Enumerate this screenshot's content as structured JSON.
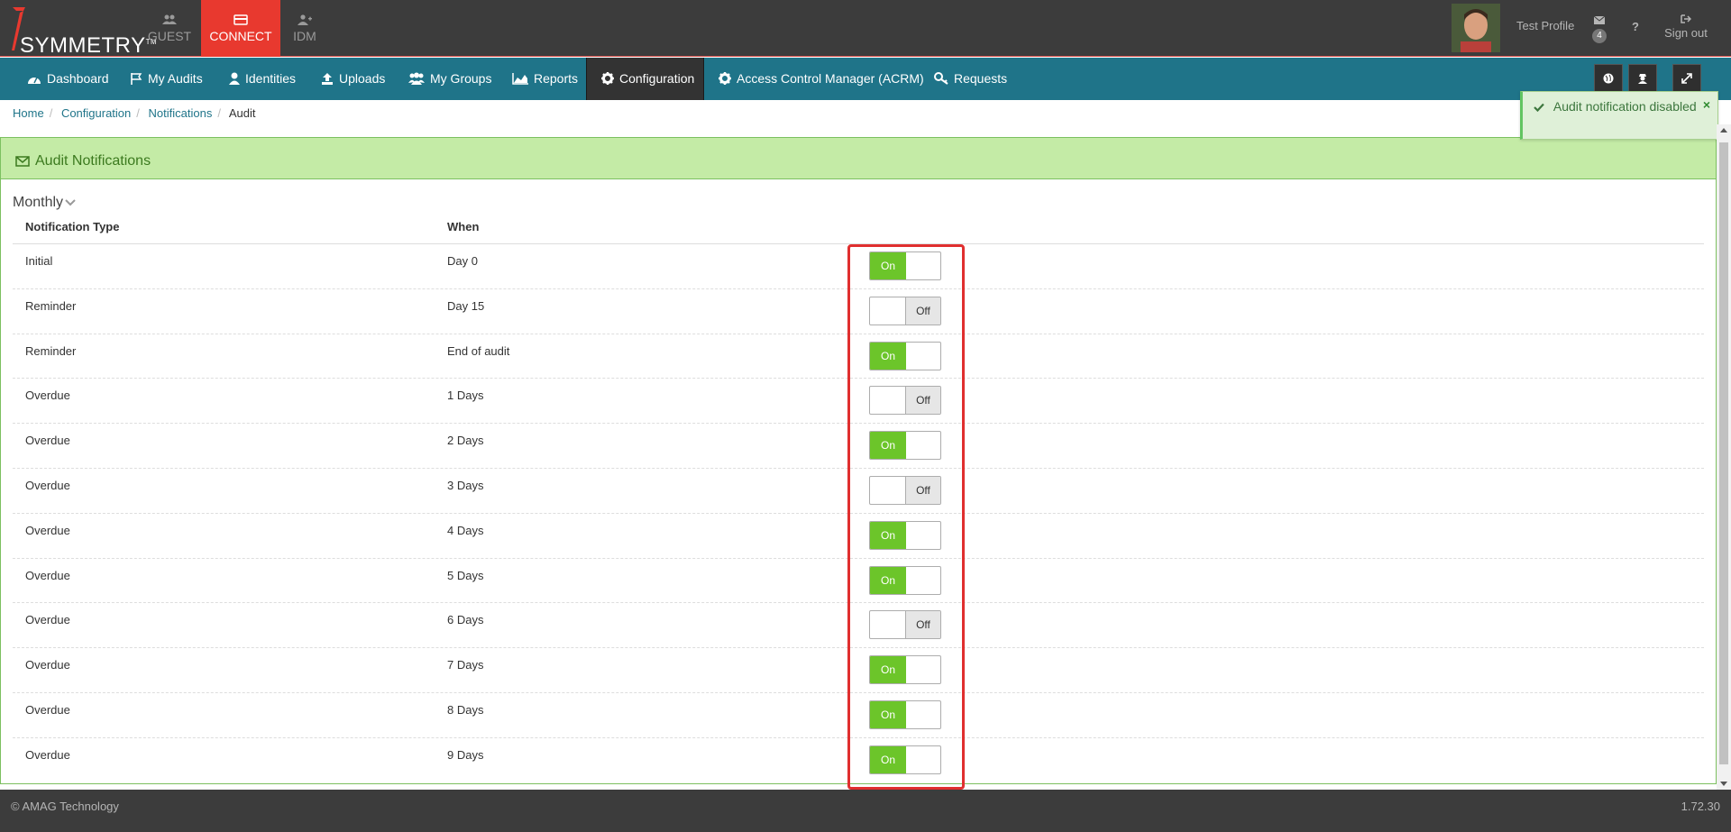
{
  "brand": {
    "name": "SYMMETRY",
    "tm": "TM"
  },
  "app_tabs": [
    {
      "label": "GUEST",
      "icon": "users-icon"
    },
    {
      "label": "CONNECT",
      "icon": "card-icon",
      "active": true
    },
    {
      "label": "IDM",
      "icon": "user-plus-icon"
    }
  ],
  "top": {
    "profile": "Test Profile",
    "messages_count": "4",
    "help": "?",
    "signout": "Sign out"
  },
  "nav": [
    {
      "label": "Dashboard",
      "icon": "dashboard-icon"
    },
    {
      "label": "My Audits",
      "icon": "flag-icon"
    },
    {
      "label": "Identities",
      "icon": "user-icon"
    },
    {
      "label": "Uploads",
      "icon": "upload-icon"
    },
    {
      "label": "My Groups",
      "icon": "group-icon"
    },
    {
      "label": "Reports",
      "icon": "area-chart-icon"
    },
    {
      "label": "Configuration",
      "icon": "gear-icon",
      "active": true
    },
    {
      "label": "Access Control Manager (ACRM)",
      "icon": "gear-icon"
    },
    {
      "label": "Requests",
      "icon": "key-icon"
    }
  ],
  "breadcrumb": [
    "Home",
    "Configuration",
    "Notifications",
    "Audit"
  ],
  "toast": {
    "message": "Audit notification disabled",
    "close": "×"
  },
  "panel": {
    "title": "Audit Notifications",
    "period": "Monthly"
  },
  "table": {
    "headers": [
      "Notification Type",
      "When"
    ],
    "rows": [
      {
        "type": "Initial",
        "when": "Day 0",
        "state": "On"
      },
      {
        "type": "Reminder",
        "when": "Day 15",
        "state": "Off"
      },
      {
        "type": "Reminder",
        "when": "End of audit",
        "state": "On"
      },
      {
        "type": "Overdue",
        "when": "1 Days",
        "state": "Off"
      },
      {
        "type": "Overdue",
        "when": "2 Days",
        "state": "On"
      },
      {
        "type": "Overdue",
        "when": "3 Days",
        "state": "Off"
      },
      {
        "type": "Overdue",
        "when": "4 Days",
        "state": "On"
      },
      {
        "type": "Overdue",
        "when": "5 Days",
        "state": "On"
      },
      {
        "type": "Overdue",
        "when": "6 Days",
        "state": "Off"
      },
      {
        "type": "Overdue",
        "when": "7 Days",
        "state": "On"
      },
      {
        "type": "Overdue",
        "when": "8 Days",
        "state": "On"
      },
      {
        "type": "Overdue",
        "when": "9 Days",
        "state": "On"
      }
    ]
  },
  "footer": {
    "copyright": "© AMAG Technology",
    "version": "1.72.30"
  },
  "colors": {
    "nav": "#1f7489",
    "active_tab": "#e8392f",
    "toggle_on": "#6cc52a",
    "highlight": "#e02f2f"
  }
}
